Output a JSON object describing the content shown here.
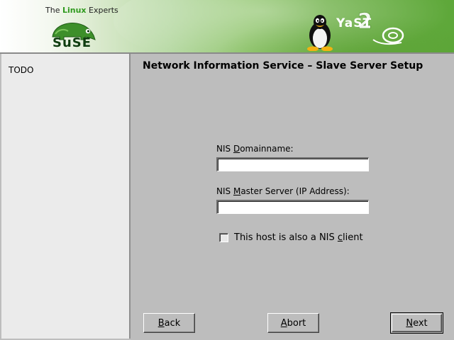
{
  "header": {
    "tagline_prefix": "The ",
    "tagline_accent": "Linux",
    "tagline_suffix": " Experts",
    "brand": "SuSE",
    "product_logo": "YaST2"
  },
  "help": {
    "text": "TODO"
  },
  "main": {
    "title": "Network Information Service – Slave Server Setup",
    "domain_field": {
      "label_pre": "NIS ",
      "label_mnemonic": "D",
      "label_post": "omainname:",
      "value": ""
    },
    "master_field": {
      "label_pre": "NIS ",
      "label_mnemonic": "M",
      "label_post": "aster Server (IP Address):",
      "value": ""
    },
    "client_checkbox": {
      "label_pre": "This host is also a NIS ",
      "label_mnemonic": "c",
      "label_post": "lient",
      "checked": false
    }
  },
  "buttons": {
    "back": {
      "mnemonic": "B",
      "rest": "ack"
    },
    "abort": {
      "mnemonic": "A",
      "rest": "bort"
    },
    "next": {
      "mnemonic": "N",
      "rest": "ext"
    }
  },
  "colors": {
    "brand_green": "#5ea83a",
    "accent_green": "#2f9a1e",
    "background": "#bdbdbd"
  },
  "icons": [
    "suse-chameleon-icon",
    "tux-penguin-icon",
    "yast-logo-icon",
    "checkbox-icon"
  ]
}
